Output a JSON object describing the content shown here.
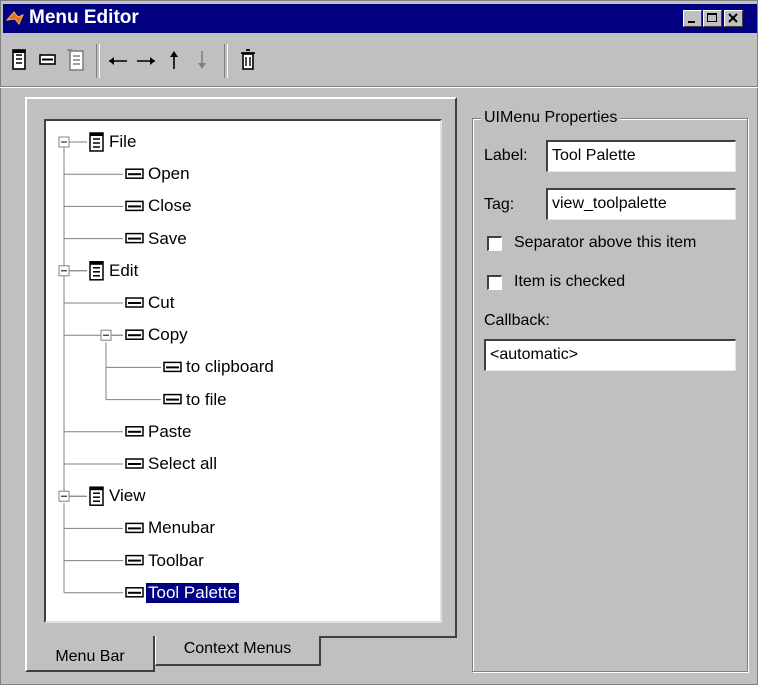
{
  "window": {
    "title": "Menu Editor"
  },
  "toolbar": {
    "buttons": [
      {
        "name": "new-menu-button",
        "icon": "new-menu-icon"
      },
      {
        "name": "new-menu-item-button",
        "icon": "new-menu-item-icon"
      },
      {
        "name": "new-context-menu-button",
        "icon": "new-context-menu-icon"
      },
      {
        "name": "move-left-button",
        "icon": "arrow-left-icon"
      },
      {
        "name": "move-right-button",
        "icon": "arrow-right-icon"
      },
      {
        "name": "move-up-button",
        "icon": "arrow-up-icon"
      },
      {
        "name": "move-down-button",
        "icon": "arrow-down-icon"
      },
      {
        "name": "delete-button",
        "icon": "trash-icon"
      }
    ]
  },
  "tree": {
    "nodes": [
      {
        "label": "File",
        "type": "menu",
        "level": 0
      },
      {
        "label": "Open",
        "type": "item",
        "level": 1
      },
      {
        "label": "Close",
        "type": "item",
        "level": 1
      },
      {
        "label": "Save",
        "type": "item",
        "level": 1
      },
      {
        "label": "Edit",
        "type": "menu",
        "level": 0
      },
      {
        "label": "Cut",
        "type": "item",
        "level": 1
      },
      {
        "label": "Copy",
        "type": "item",
        "level": 1
      },
      {
        "label": "to clipboard",
        "type": "item",
        "level": 2
      },
      {
        "label": "to file",
        "type": "item",
        "level": 2
      },
      {
        "label": "Paste",
        "type": "item",
        "level": 1
      },
      {
        "label": "Select all",
        "type": "item",
        "level": 1
      },
      {
        "label": "View",
        "type": "menu",
        "level": 0
      },
      {
        "label": "Menubar",
        "type": "item",
        "level": 1
      },
      {
        "label": "Toolbar",
        "type": "item",
        "level": 1
      },
      {
        "label": "Tool Palette",
        "type": "item",
        "level": 1,
        "selected": true
      }
    ]
  },
  "tabs": {
    "menu_bar": "Menu Bar",
    "context_menus": "Context Menus"
  },
  "properties": {
    "group_title": "UIMenu Properties",
    "label_caption": "Label:",
    "label_value": "Tool Palette",
    "tag_caption": "Tag:",
    "tag_value": "view_toolpalette",
    "separator_caption": "Separator above this item",
    "separator_checked": false,
    "checked_caption": "Item is checked",
    "checked_checked": false,
    "callback_caption": "Callback:",
    "callback_value": "<automatic>"
  },
  "colors": {
    "titlebar": "#000080",
    "selection": "#000080",
    "face": "#c0c0c0"
  }
}
